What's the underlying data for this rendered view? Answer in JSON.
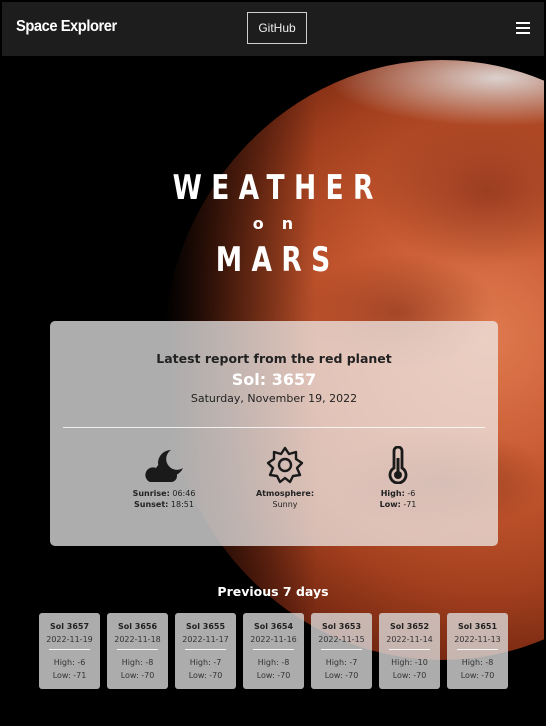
{
  "navbar": {
    "brand": "Space Explorer",
    "github_label": "GitHub",
    "menu_icon": "hamburger-menu-icon"
  },
  "hero": {
    "line1": "WEATHER",
    "line2": "on",
    "line3": "MARS"
  },
  "latest": {
    "heading": "Latest report from the red planet",
    "sol": "Sol: 3657",
    "date": "Saturday, November 19, 2022",
    "sun": {
      "icon": "moon-cloud-icon",
      "sunrise_label": "Sunrise:",
      "sunrise_value": "06:46",
      "sunset_label": "Sunset:",
      "sunset_value": "18:51"
    },
    "atmosphere": {
      "icon": "sun-icon",
      "label": "Atmosphere:",
      "value": "Sunny"
    },
    "temperature": {
      "icon": "thermometer-icon",
      "high_label": "High:",
      "high_value": "-6",
      "low_label": "Low:",
      "low_value": "-71"
    }
  },
  "previous": {
    "title": "Previous 7 days",
    "days": [
      {
        "sol": "Sol 3657",
        "date": "2022-11-19",
        "high": "High: -6",
        "low": "Low: -71"
      },
      {
        "sol": "Sol 3656",
        "date": "2022-11-18",
        "high": "High: -8",
        "low": "Low: -70"
      },
      {
        "sol": "Sol 3655",
        "date": "2022-11-17",
        "high": "High: -7",
        "low": "Low: -70"
      },
      {
        "sol": "Sol 3654",
        "date": "2022-11-16",
        "high": "High: -8",
        "low": "Low: -70"
      },
      {
        "sol": "Sol 3653",
        "date": "2022-11-15",
        "high": "High: -7",
        "low": "Low: -70"
      },
      {
        "sol": "Sol 3652",
        "date": "2022-11-14",
        "high": "High: -10",
        "low": "Low: -70"
      },
      {
        "sol": "Sol 3651",
        "date": "2022-11-13",
        "high": "High: -8",
        "low": "Low: -70"
      }
    ]
  }
}
